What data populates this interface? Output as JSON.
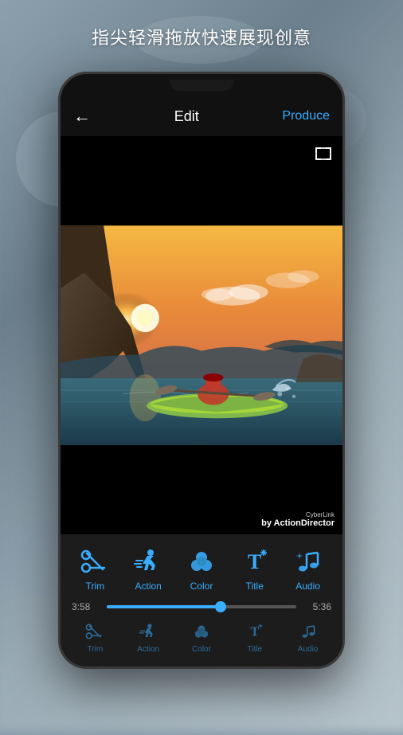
{
  "background": {
    "tagline": "指尖轻滑拖放快速展现创意"
  },
  "header": {
    "back_label": "←",
    "title": "Edit",
    "produce_label": "Produce"
  },
  "watermark": {
    "line1": "CyberLink",
    "line2": "by ActionDirector"
  },
  "timeline": {
    "start_time": "3:58",
    "end_time": "5:36",
    "progress_percent": 60
  },
  "tools_primary": [
    {
      "id": "trim",
      "label": "Trim",
      "icon": "scissors"
    },
    {
      "id": "action",
      "label": "Action",
      "icon": "action"
    },
    {
      "id": "color",
      "label": "Color",
      "icon": "color"
    },
    {
      "id": "title",
      "label": "Title",
      "icon": "title"
    },
    {
      "id": "audio",
      "label": "Audio",
      "icon": "audio"
    }
  ],
  "tools_secondary": [
    {
      "id": "trim2",
      "label": "Trim",
      "icon": "scissors"
    },
    {
      "id": "action2",
      "label": "Action",
      "icon": "action"
    },
    {
      "id": "color2",
      "label": "Color",
      "icon": "color"
    },
    {
      "id": "title2",
      "label": "Title",
      "icon": "title"
    },
    {
      "id": "audio2",
      "label": "Audio",
      "icon": "audio"
    }
  ],
  "colors": {
    "accent": "#3aadff",
    "bg_dark": "#111111",
    "toolbar_bg": "#1c1c1c"
  }
}
